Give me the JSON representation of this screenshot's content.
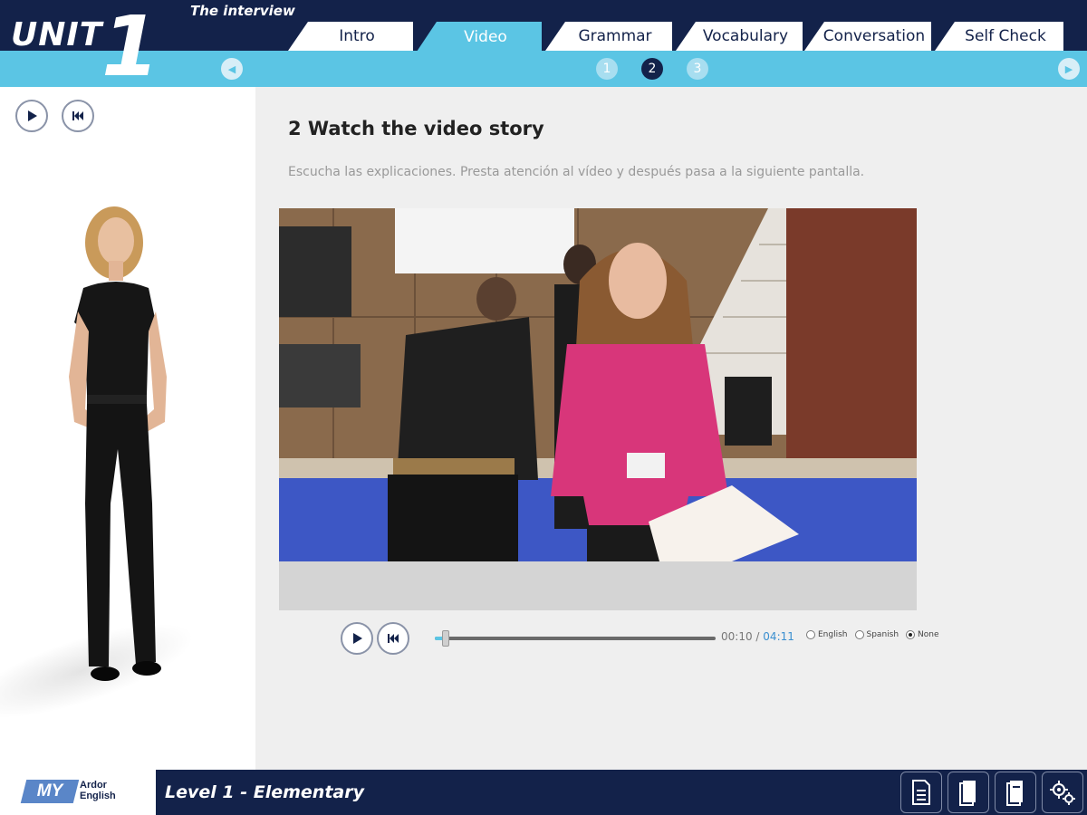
{
  "header": {
    "unit_label": "UNIT",
    "unit_number": "1",
    "subtitle": "The interview",
    "tabs": [
      {
        "label": "Intro",
        "active": false
      },
      {
        "label": "Video",
        "active": true
      },
      {
        "label": "Grammar",
        "active": false
      },
      {
        "label": "Vocabulary",
        "active": false
      },
      {
        "label": "Conversation",
        "active": false
      },
      {
        "label": "Self Check",
        "active": false
      }
    ],
    "steps": [
      "1",
      "2",
      "3"
    ],
    "active_step": "2"
  },
  "main": {
    "title": "2 Watch the video story",
    "instructions": "Escucha las explicaciones. Presta atención al vídeo y después pasa a la siguiente pantalla."
  },
  "player": {
    "current_time": "00:10",
    "separator": "/",
    "total_time": "04:11",
    "progress": 0.04,
    "subtitle_options": [
      {
        "label": "English",
        "selected": false
      },
      {
        "label": "Spanish",
        "selected": false
      },
      {
        "label": "None",
        "selected": true
      }
    ]
  },
  "footer": {
    "brand_mark": "MY",
    "brand_line1": "Ardor",
    "brand_line2": "English",
    "level": "Level 1 - Elementary"
  },
  "colors": {
    "navy": "#13224a",
    "accent": "#5bc5e4",
    "content_bg": "#efefef"
  }
}
